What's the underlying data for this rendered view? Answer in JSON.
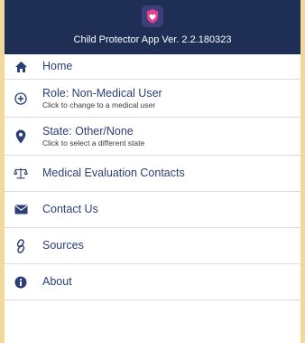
{
  "header": {
    "title": "Child Protector App Ver. 2.2.180323",
    "logo_icon": "shield-heart-icon"
  },
  "menu": {
    "home": {
      "label": "Home",
      "icon": "home-icon"
    },
    "role": {
      "label": "Role: Non-Medical User",
      "sub": "Click to change to a medical user",
      "icon": "plus-circle-icon"
    },
    "state": {
      "label": "State: Other/None",
      "sub": "Click to select a different state",
      "icon": "map-pin-icon"
    },
    "contacts": {
      "label": "Medical Evaluation Contacts",
      "icon": "scales-icon"
    },
    "contact_us": {
      "label": "Contact Us",
      "icon": "envelope-icon"
    },
    "sources": {
      "label": "Sources",
      "icon": "link-icon"
    },
    "about": {
      "label": "About",
      "icon": "info-icon"
    }
  },
  "colors": {
    "header_bg": "#1f2e55",
    "accent": "#2b3f77",
    "outer_bg": "#f5dfa8"
  }
}
